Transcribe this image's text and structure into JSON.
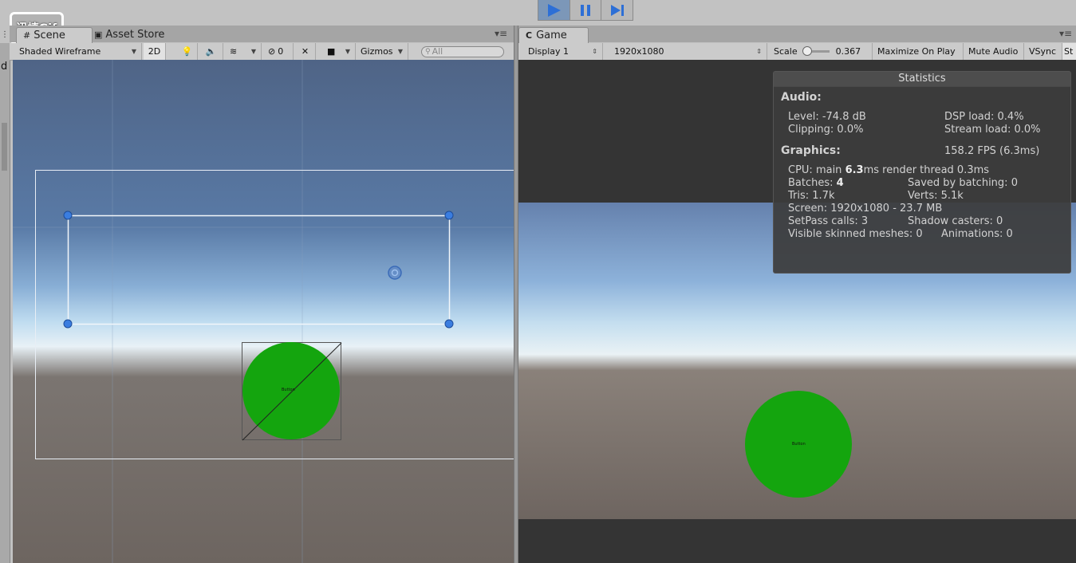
{
  "watermark": "迅捷Gif",
  "left_strip": {
    "labels": [
      "⋮",
      "d"
    ]
  },
  "scene_tabs": {
    "scene": "Scene",
    "asset_store": "Asset Store"
  },
  "game_tab": {
    "label": "Game"
  },
  "scene_toolbar": {
    "shading": "Shaded Wireframe",
    "two_d": "2D",
    "hidden_count": "0",
    "gizmos": "Gizmos",
    "search_placeholder": "All"
  },
  "game_toolbar": {
    "display": "Display 1",
    "resolution": "1920x1080",
    "scale_label": "Scale",
    "scale_value": "0.367",
    "maximize": "Maximize On Play",
    "mute": "Mute Audio",
    "vsync": "VSync",
    "stats": "St"
  },
  "scene_objects": {
    "button_text": "Button"
  },
  "game_objects": {
    "button_text": "Button"
  },
  "statistics": {
    "title": "Statistics",
    "audio_header": "Audio:",
    "level": "Level: -74.8 dB",
    "dsp": "DSP load: 0.4%",
    "clipping": "Clipping: 0.0%",
    "stream": "Stream load: 0.0%",
    "graphics_header": "Graphics:",
    "fps": "158.2 FPS (6.3ms)",
    "cpu_prefix": "CPU: main ",
    "cpu_main": "6.3",
    "cpu_suffix": "ms  render thread 0.3ms",
    "batches_prefix": "Batches: ",
    "batches": "4",
    "saved": "Saved by batching: 0",
    "tris": "Tris: 1.7k",
    "verts": "Verts: 5.1k",
    "screen": "Screen: 1920x1080 - 23.7 MB",
    "setpass": "SetPass calls: 3",
    "shadow": "Shadow casters: 0",
    "skinned": "Visible skinned meshes: 0",
    "animations": "Animations: 0"
  },
  "colors": {
    "play_blue": "#2d6fd6",
    "circle_green": "#14a50e",
    "stats_bg": "#3c3c3c"
  }
}
